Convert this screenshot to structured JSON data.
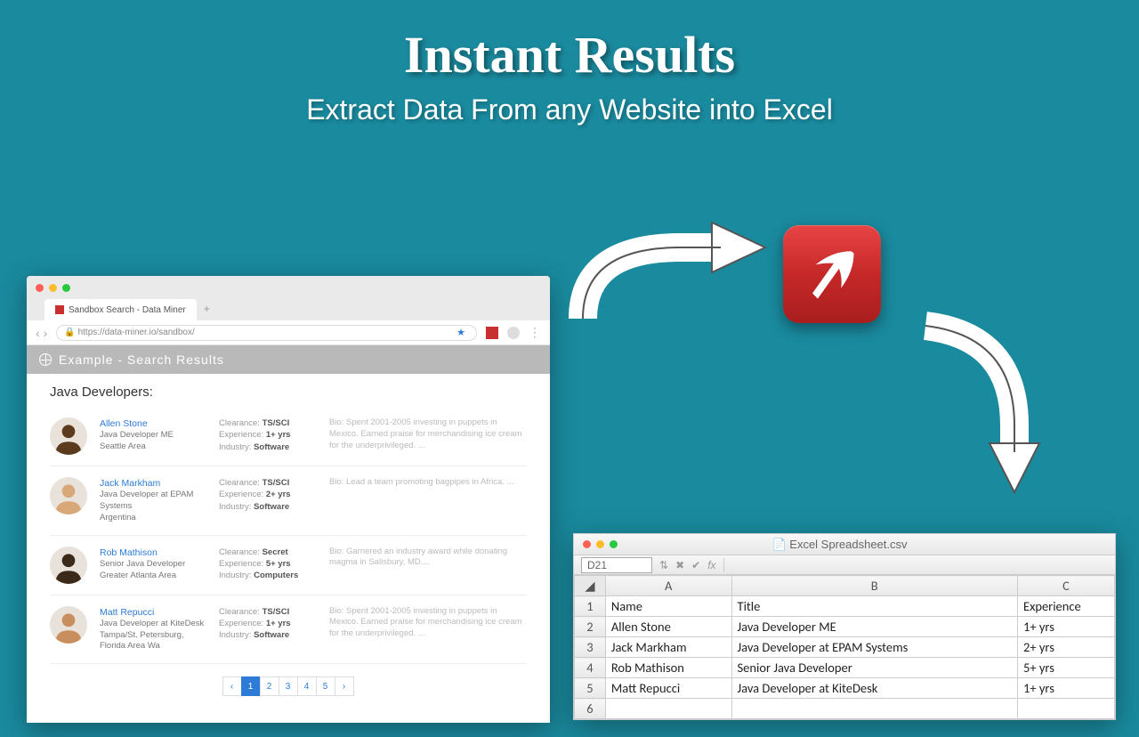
{
  "hero": {
    "title": "Instant Results",
    "subtitle": "Extract Data From any Website into Excel"
  },
  "browser": {
    "tab_title": "Sandbox Search - Data Miner",
    "url": "https://data-miner.io/sandbox/",
    "page_header": "Example - Search Results",
    "page_title": "Java Developers:",
    "results": [
      {
        "name": "Allen Stone",
        "title": "Java Developer ME",
        "location": "Seattle Area",
        "clearance": "TS/SCI",
        "experience": "1+ yrs",
        "industry": "Software",
        "bio": "Bio: Spent 2001-2005 investing in puppets in Mexico. Earned praise for merchandising ice cream for the underprivileged. ..."
      },
      {
        "name": "Jack Markham",
        "title": "Java Developer at EPAM Systems",
        "location": "Argentina",
        "clearance": "TS/SCI",
        "experience": "2+ yrs",
        "industry": "Software",
        "bio": "Bio: Lead a team promoting bagpipes in Africa. ..."
      },
      {
        "name": "Rob Mathison",
        "title": "Senior Java Developer",
        "location": "Greater Atlanta Area",
        "clearance": "Secret",
        "experience": "5+ yrs",
        "industry": "Computers",
        "bio": "Bio: Garnered an industry award while donating magma in Salisbury, MD...."
      },
      {
        "name": "Matt Repucci",
        "title": "Java Developer at KiteDesk",
        "location": "Tampa/St. Petersburg, Florida Area Wa",
        "clearance": "TS/SCI",
        "experience": "1+ yrs",
        "industry": "Software",
        "bio": "Bio: Spent 2001-2005 investing in puppets in Mexico. Earned praise for merchandising ice cream for the underprivileged. ..."
      }
    ],
    "meta_labels": {
      "clearance": "Clearance:",
      "experience": "Experience:",
      "industry": "Industry:"
    },
    "pagination": [
      "‹",
      "1",
      "2",
      "3",
      "4",
      "5",
      "›"
    ],
    "active_page": 1
  },
  "spreadsheet": {
    "filename": "Excel Spreadsheet.csv",
    "cell_ref": "D21",
    "fx_label": "fx",
    "columns": [
      "A",
      "B",
      "C"
    ],
    "headers": [
      "Name",
      "Title",
      "Experience"
    ],
    "rows": [
      [
        "Allen Stone",
        "Java Developer ME",
        "1+ yrs"
      ],
      [
        "Jack Markham",
        "Java Developer at EPAM Systems",
        "2+ yrs"
      ],
      [
        "Rob Mathison",
        "Senior Java Developer",
        "5+ yrs"
      ],
      [
        "Matt Repucci",
        "Java Developer at KiteDesk",
        "1+ yrs"
      ],
      [
        "",
        "",
        ""
      ]
    ]
  }
}
